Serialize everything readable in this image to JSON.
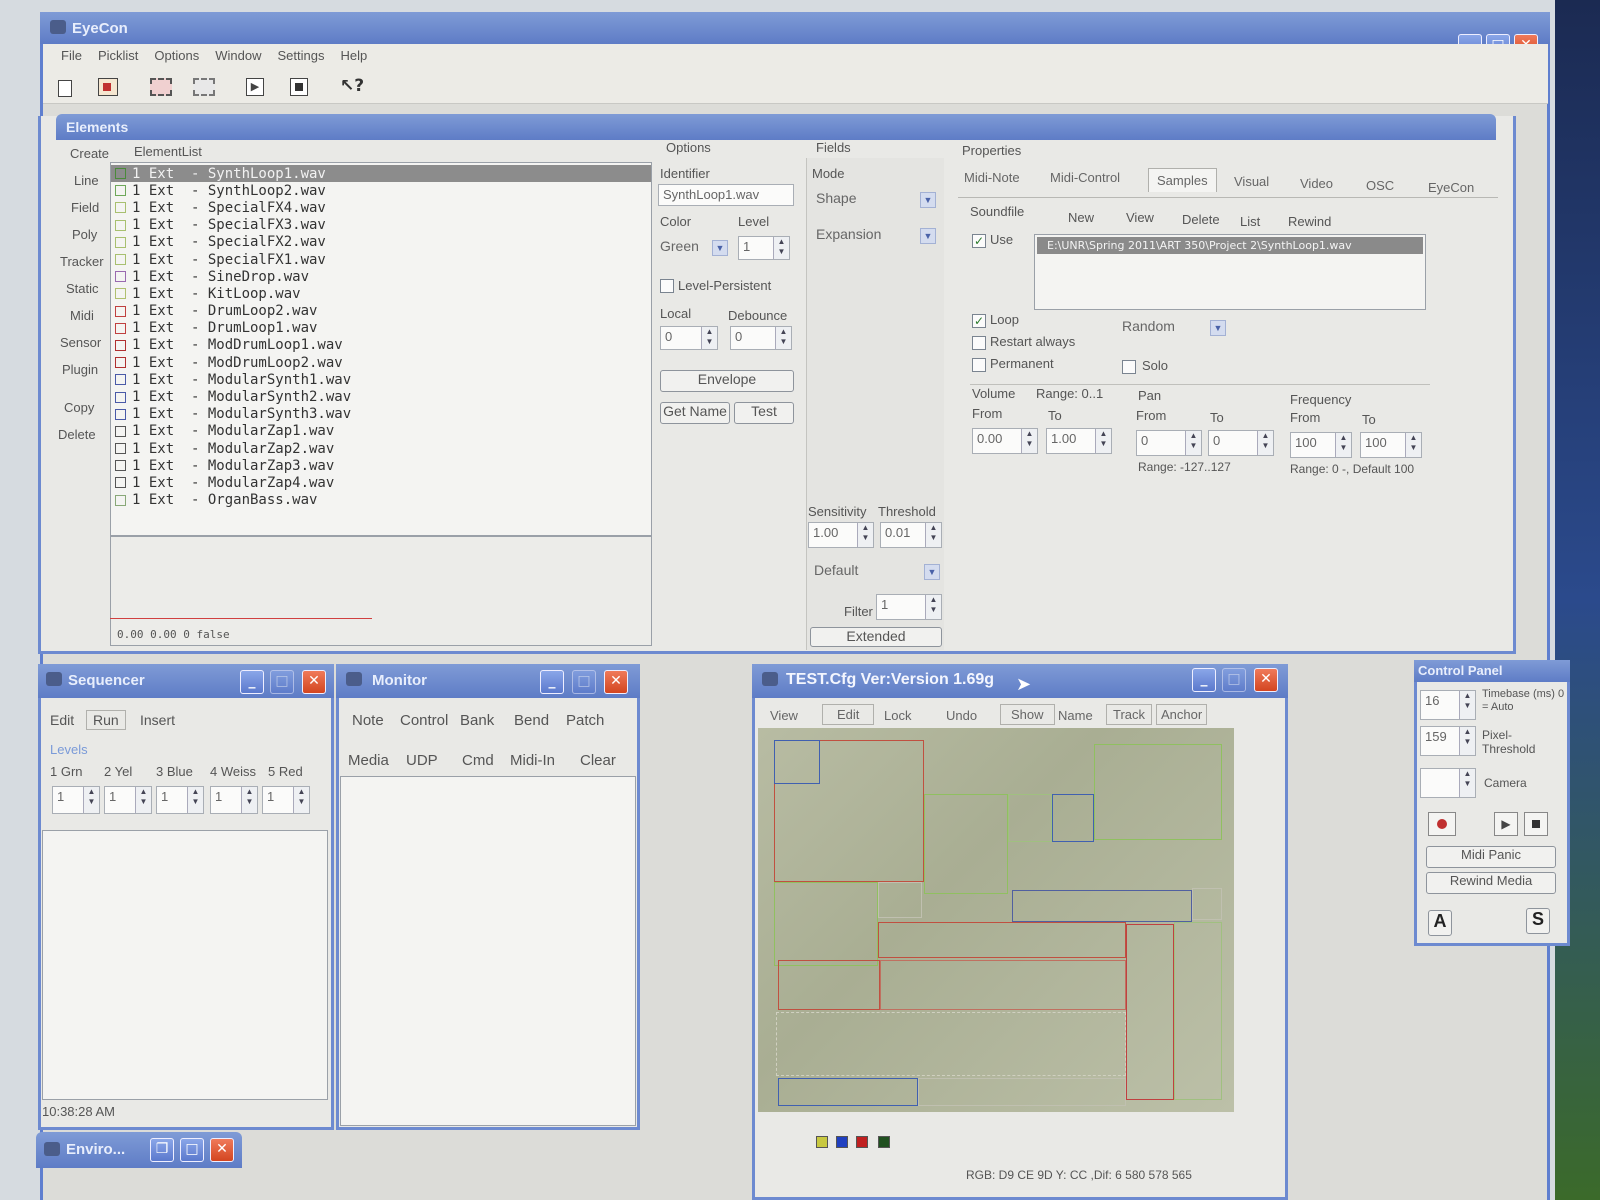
{
  "app": {
    "title": "EyeCon"
  },
  "menu": [
    "File",
    "Picklist",
    "Options",
    "Window",
    "Settings",
    "Help"
  ],
  "toolbar_icons": [
    "new-file-icon",
    "open-file-icon",
    "film-strip-icon",
    "film-strip-alt-icon",
    "play-icon",
    "stop-icon",
    "help-cursor-icon"
  ],
  "elements": {
    "title": "Elements",
    "create_label": "Create",
    "elementlist_label": "ElementList",
    "create_items": [
      "Line",
      "Field",
      "Poly",
      "Tracker",
      "Static",
      "Midi",
      "Sensor",
      "Plugin",
      "Copy",
      "Delete"
    ],
    "list": [
      {
        "text": "1 Ext  - SynthLoop1.wav",
        "color": "#4a8a3a"
      },
      {
        "text": "1 Ext  - SynthLoop2.wav",
        "color": "#6ea85a"
      },
      {
        "text": "1 Ext  - SpecialFX4.wav",
        "color": "#a8c070"
      },
      {
        "text": "1 Ext  - SpecialFX3.wav",
        "color": "#a8c070"
      },
      {
        "text": "1 Ext  - SpecialFX2.wav",
        "color": "#a8c070"
      },
      {
        "text": "1 Ext  - SpecialFX1.wav",
        "color": "#a8c070"
      },
      {
        "text": "1 Ext  - SineDrop.wav",
        "color": "#9a6ab0"
      },
      {
        "text": "1 Ext  - KitLoop.wav",
        "color": "#b0c070"
      },
      {
        "text": "1 Ext  - DrumLoop2.wav",
        "color": "#c04040"
      },
      {
        "text": "1 Ext  - DrumLoop1.wav",
        "color": "#c04040"
      },
      {
        "text": "1 Ext  - ModDrumLoop1.wav",
        "color": "#b03030"
      },
      {
        "text": "1 Ext  - ModDrumLoop2.wav",
        "color": "#b03030"
      },
      {
        "text": "1 Ext  - ModularSynth1.wav",
        "color": "#4a5aa8"
      },
      {
        "text": "1 Ext  - ModularSynth2.wav",
        "color": "#4a5aa8"
      },
      {
        "text": "1 Ext  - ModularSynth3.wav",
        "color": "#4a5aa8"
      },
      {
        "text": "1 Ext  - ModularZap1.wav",
        "color": "#555555"
      },
      {
        "text": "1 Ext  - ModularZap2.wav",
        "color": "#555555"
      },
      {
        "text": "1 Ext  - ModularZap3.wav",
        "color": "#555555"
      },
      {
        "text": "1 Ext  - ModularZap4.wav",
        "color": "#555555"
      },
      {
        "text": "1 Ext  - OrganBass.wav",
        "color": "#88a878"
      }
    ],
    "status": "0.00  0.00 0 false"
  },
  "options": {
    "header": "Options",
    "identifier_label": "Identifier",
    "identifier_value": "SynthLoop1.wav",
    "color_label": "Color",
    "color_value": "Green",
    "level_label": "Level",
    "level_value": "1",
    "level_persistent_label": "Level-Persistent",
    "local_label": "Local",
    "local_value": "0",
    "debounce_label": "Debounce",
    "debounce_value": "0",
    "envelope_button": "Envelope",
    "getname_button": "Get Name",
    "test_button": "Test"
  },
  "fields": {
    "header": "Fields",
    "mode_label": "Mode",
    "mode_value": "Shape",
    "expansion_value": "Expansion",
    "sensitivity_label": "Sensitivity",
    "threshold_label": "Threshold",
    "sensitivity_value": "1.00",
    "threshold_value": "0.01",
    "default_value": "Default",
    "filter_label": "Filter",
    "filter_value": "1",
    "extended_button": "Extended"
  },
  "properties": {
    "header": "Properties",
    "tabs": [
      "Midi-Note",
      "Midi-Control",
      "Samples",
      "Visual",
      "Video",
      "OSC",
      "EyeCon"
    ],
    "active_tab": "Samples",
    "soundfile_label": "Soundfile",
    "sound_actions": [
      "New",
      "View",
      "Delete",
      "List",
      "Rewind"
    ],
    "use_label": "Use",
    "file_path": "E:\\UNR\\Spring 2011\\ART 350\\Project 2\\SynthLoop1.wav",
    "loop_label": "Loop",
    "random_value": "Random",
    "restart_label": "Restart always",
    "permanent_label": "Permanent",
    "solo_label": "Solo",
    "volume_label": "Volume",
    "volume_range": "Range: 0..1",
    "from_label": "From",
    "to_label": "To",
    "volume_from": "0.00",
    "volume_to": "1.00",
    "pan_label": "Pan",
    "pan_from": "0",
    "pan_to": "0",
    "pan_range": "Range: -127..127",
    "frequency_label": "Frequency",
    "freq_from": "100",
    "freq_to": "100",
    "freq_range": "Range: 0 -, Default 100"
  },
  "sequencer": {
    "title": "Sequencer",
    "menu": [
      "Edit",
      "Run",
      "Insert"
    ],
    "levels_label": "Levels",
    "levels": [
      "1 Grn",
      "2 Yel",
      "3 Blue",
      "4 Weiss",
      "5 Red"
    ],
    "level_values": [
      "1",
      "1",
      "1",
      "1",
      "1"
    ],
    "time": "10:38:28 AM"
  },
  "monitor": {
    "title": "Monitor",
    "row1": [
      "Note",
      "Control",
      "Bank",
      "Bend",
      "Patch"
    ],
    "row2": [
      "Media",
      "UDP",
      "Cmd",
      "Midi-In",
      "Clear"
    ]
  },
  "test_cfg": {
    "title": "TEST.Cfg Ver:Version 1.69g",
    "toolbar": [
      "View",
      "Edit",
      "Lock",
      "Undo",
      "Show",
      "Name",
      "Track",
      "Anchor"
    ],
    "status": "RGB: D9 CE 9D  Y: CC ,Dif: 6 580 578 565",
    "swatches": [
      "#c8c840",
      "#2040c0",
      "#c02020",
      "#205020"
    ]
  },
  "control_panel": {
    "title": "Control Panel",
    "timebase_value": "16",
    "timebase_label": "Timebase (ms) 0 = Auto",
    "pixel_value": "159",
    "pixel_label": "Pixel-Threshold",
    "camera_label": "Camera",
    "midi_panic": "Midi Panic",
    "rewind_media": "Rewind Media",
    "a_button": "A",
    "s_button": "S"
  },
  "enviro": {
    "title": "Enviro..."
  }
}
